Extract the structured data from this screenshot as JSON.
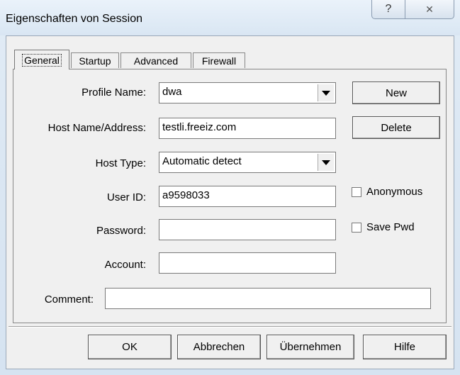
{
  "window": {
    "title": "Eigenschaften von Session",
    "help_icon": "?",
    "close_icon": "✕"
  },
  "tabs": [
    {
      "label": "General",
      "active": true
    },
    {
      "label": "Startup",
      "active": false
    },
    {
      "label": "Advanced",
      "active": false
    },
    {
      "label": "Firewall",
      "active": false
    }
  ],
  "form": {
    "profile_name": {
      "label": "Profile Name:",
      "value": "dwa"
    },
    "host": {
      "label": "Host Name/Address:",
      "value": "testli.freeiz.com"
    },
    "host_type": {
      "label": "Host Type:",
      "value": "Automatic detect"
    },
    "user_id": {
      "label": "User ID:",
      "value": "a9598033"
    },
    "password": {
      "label": "Password:",
      "value": ""
    },
    "account": {
      "label": "Account:",
      "value": ""
    },
    "comment": {
      "label": "Comment:",
      "value": ""
    },
    "anonymous": {
      "label": "Anonymous",
      "checked": false
    },
    "save_pwd": {
      "label": "Save Pwd",
      "checked": false
    }
  },
  "side_buttons": {
    "new": "New",
    "delete": "Delete"
  },
  "footer_buttons": {
    "ok": "OK",
    "cancel": "Abbrechen",
    "apply": "Übernehmen",
    "help": "Hilfe"
  }
}
